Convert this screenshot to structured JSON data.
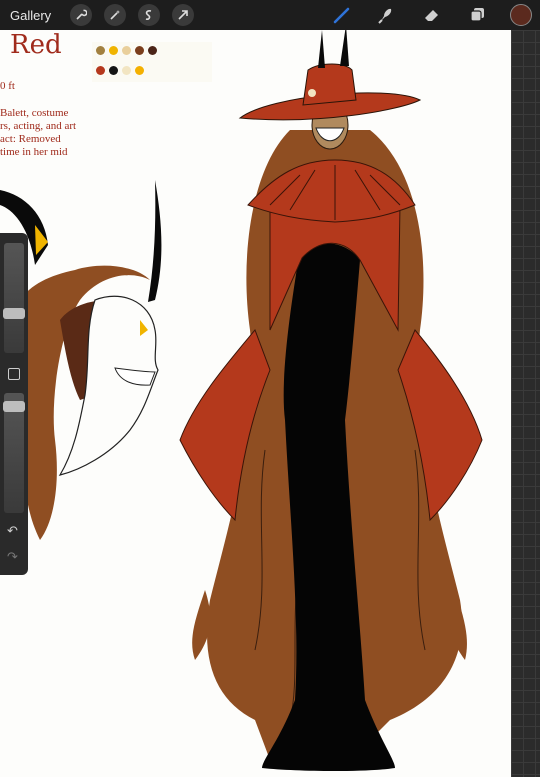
{
  "toolbar": {
    "gallery_label": "Gallery",
    "left_tools": [
      "wrench-icon",
      "magic-wand-icon",
      "selection-icon",
      "transform-icon"
    ],
    "right_tools": [
      "brush-icon",
      "smudge-icon",
      "eraser-icon",
      "layers-icon"
    ],
    "active_tool": "brush",
    "brush_color": "#2f73d8",
    "current_color": "#5b2a1e"
  },
  "canvas": {
    "title": "Red",
    "height_text": "0 ft",
    "notes": [
      "Balett, costume",
      "rs, acting, and art",
      "act: Removed",
      "time in her mid"
    ]
  },
  "palette": {
    "row1": [
      "#a2803f",
      "#f0b400",
      "#e9cf9b",
      "#7b3e1c",
      "#4b2417"
    ],
    "row2": [
      "#b5381d",
      "#141414",
      "#f2e5c2",
      "#f4b000"
    ]
  },
  "colors": {
    "red": "#b4391c",
    "hair": "#8f4e22",
    "dress": "#050505"
  }
}
